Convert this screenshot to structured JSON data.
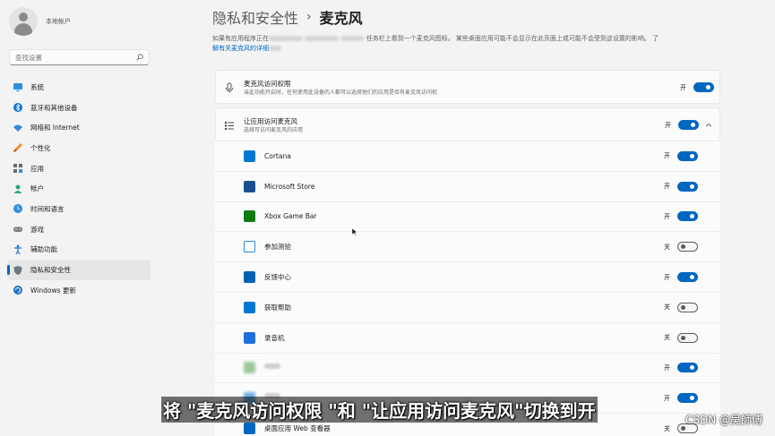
{
  "user": {
    "name": "",
    "account_type": "本地帐户"
  },
  "search": {
    "placeholder": "查找设置"
  },
  "nav": [
    {
      "label": "系统",
      "icon": "system-icon"
    },
    {
      "label": "蓝牙和其他设备",
      "icon": "bluetooth-icon"
    },
    {
      "label": "网络和 Internet",
      "icon": "network-icon"
    },
    {
      "label": "个性化",
      "icon": "brush-icon"
    },
    {
      "label": "应用",
      "icon": "apps-icon"
    },
    {
      "label": "帐户",
      "icon": "account-icon"
    },
    {
      "label": "时间和语言",
      "icon": "globe-clock-icon"
    },
    {
      "label": "游戏",
      "icon": "gamepad-icon"
    },
    {
      "label": "辅助功能",
      "icon": "accessibility-icon"
    },
    {
      "label": "隐私和安全性",
      "icon": "shield-icon",
      "active": true
    },
    {
      "label": "Windows 更新",
      "icon": "update-icon"
    }
  ],
  "breadcrumb": {
    "parent": "隐私和安全性",
    "separator": "›",
    "current": "麦克风"
  },
  "description": {
    "part1": "如果有应用程序正在",
    "part2": "任务栏上看到一个麦克风图标。 某些桌面应用可能不会显示在此页面上或可能不会受到这设置的影响。",
    "part3": "了",
    "link": "解有关麦克风的详细"
  },
  "mic_access": {
    "title": "麦克风访问权限",
    "subtitle": "当此功能开启时，任何使用此设备的人都可以选择他们的应用是否有麦克风访问权",
    "state": "开"
  },
  "app_access": {
    "title": "让应用访问麦克风",
    "subtitle": "选择可访问麦克风的应用",
    "state": "开"
  },
  "apps": [
    {
      "name": "Cortana",
      "state": "开",
      "on": true,
      "color": "#0078d4"
    },
    {
      "name": "Microsoft Store",
      "state": "开",
      "on": true,
      "color": "#1a5fb4"
    },
    {
      "name": "Xbox Game Bar",
      "state": "开",
      "on": true,
      "color": "#107c10"
    },
    {
      "name": "参加测验",
      "state": "关",
      "on": false,
      "color": "#2b88d8"
    },
    {
      "name": "反馈中心",
      "state": "开",
      "on": true,
      "color": "#0063b1"
    },
    {
      "name": "获取帮助",
      "state": "关",
      "on": false,
      "color": "#0078d4"
    },
    {
      "name": "录音机",
      "state": "关",
      "on": false,
      "color": "#1e6fd9"
    },
    {
      "name": "",
      "state": "开",
      "on": true,
      "color": "#7fbf7f",
      "blurred": true
    },
    {
      "name": "",
      "state": "开",
      "on": true,
      "color": "#4aa3df",
      "blurred": true
    },
    {
      "name": "桌面应用 Web 查看器",
      "state": "关",
      "on": false,
      "color": "#0067c0"
    }
  ],
  "caption": "将 \"麦克风访问权限 \"和 \"让应用访问麦克风\"切换到开",
  "watermark": "CSDN @吴師傅"
}
